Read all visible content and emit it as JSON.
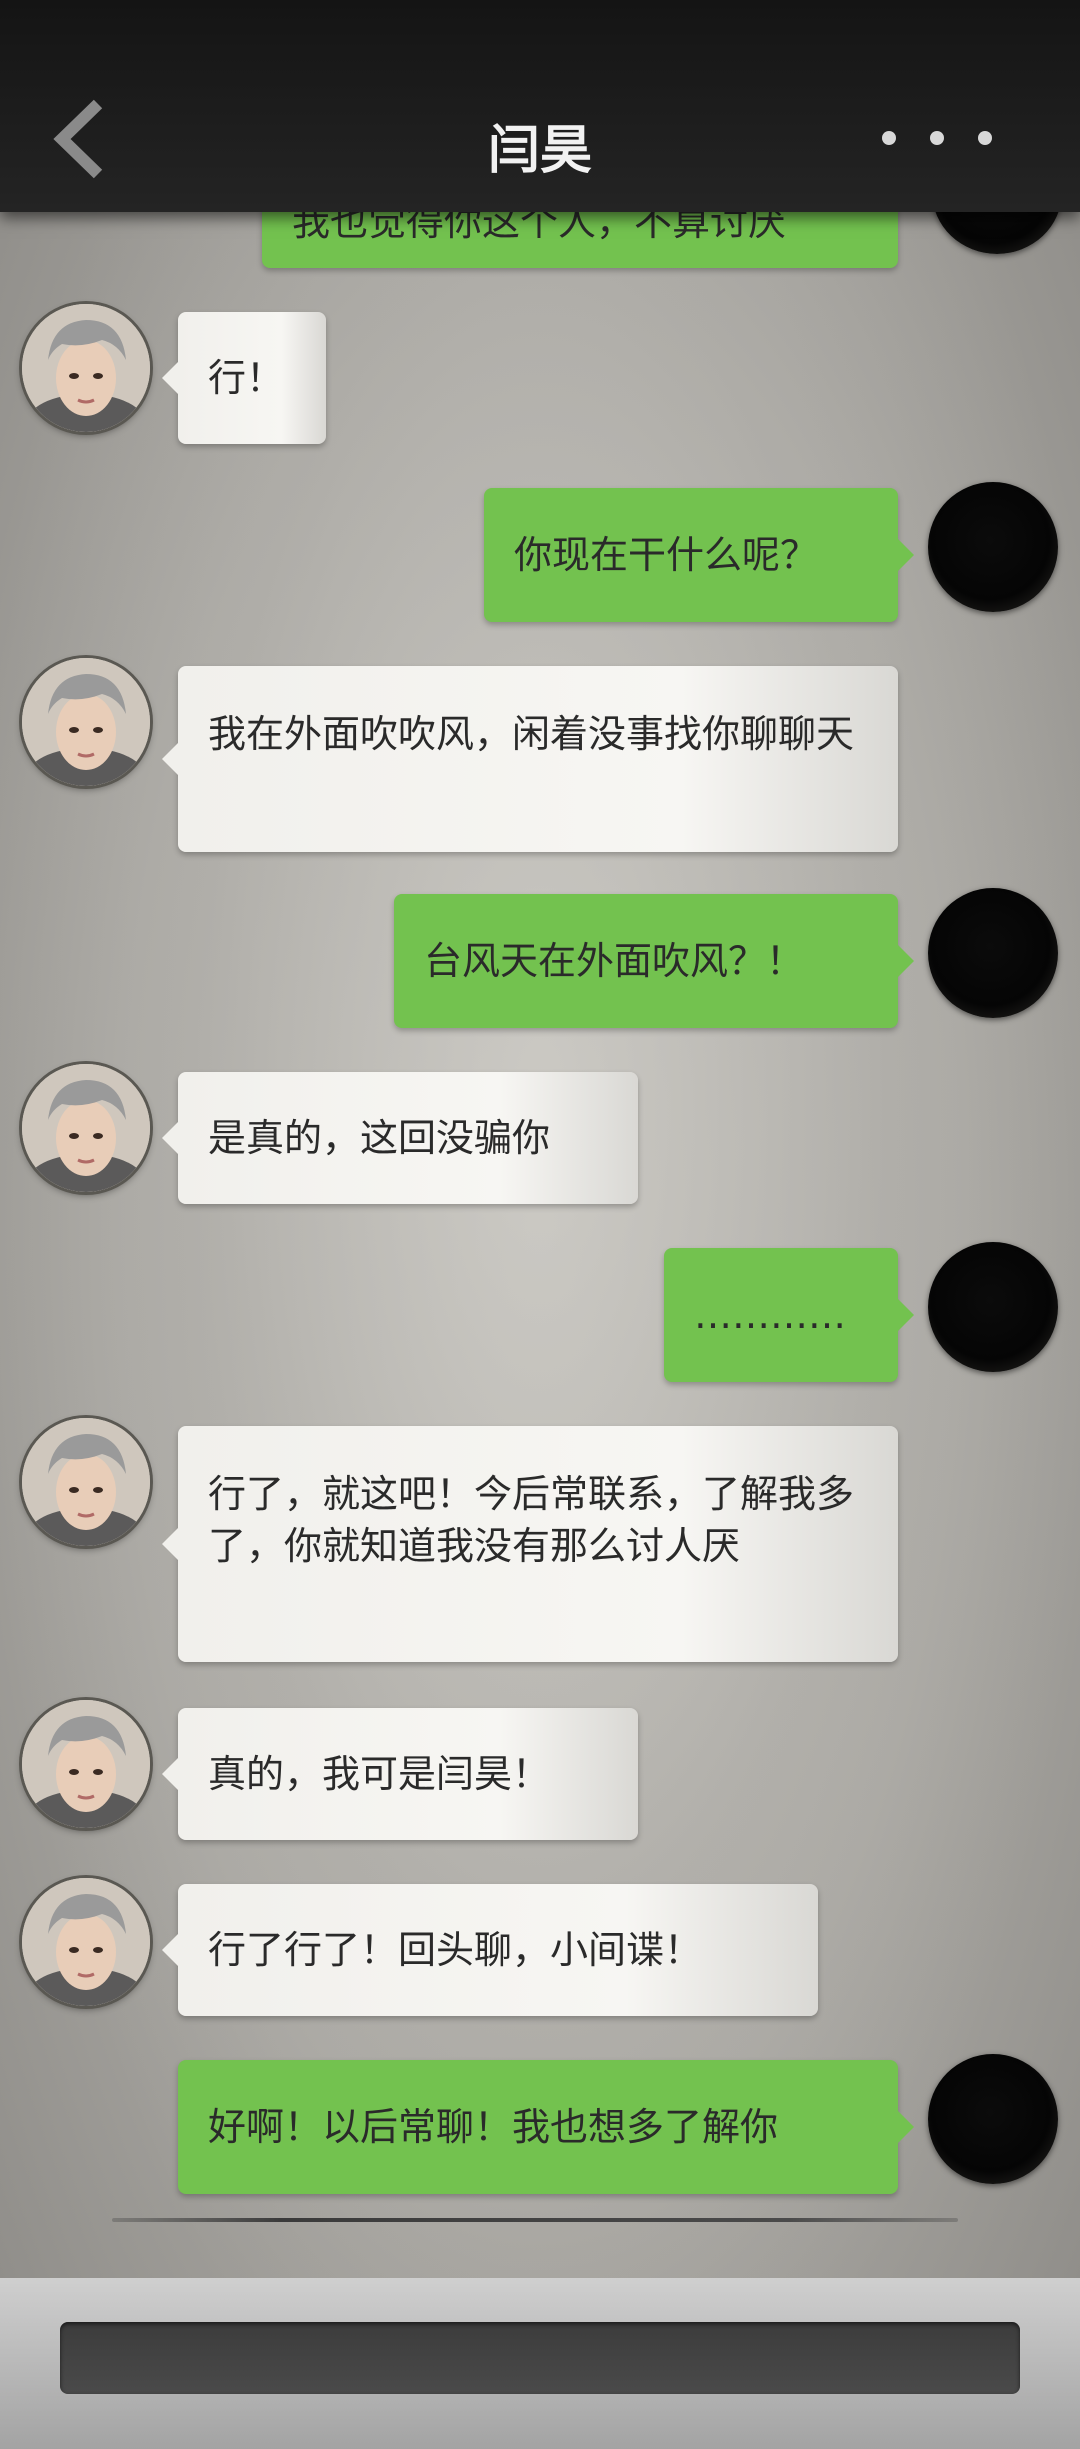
{
  "header": {
    "title": "闫昊",
    "back_icon": "chevron-left-icon",
    "more_icon": "more-dots-icon"
  },
  "messages": [
    {
      "side": "right",
      "text": "我也觉得你这个人，不算讨厌",
      "partial": true
    },
    {
      "side": "left",
      "text": "行！"
    },
    {
      "side": "right",
      "text": "你现在干什么呢？"
    },
    {
      "side": "left",
      "text": "我在外面吹吹风，闲着没事找你聊聊天"
    },
    {
      "side": "right",
      "text": "台风天在外面吹风？！"
    },
    {
      "side": "left",
      "text": "是真的，这回没骗你"
    },
    {
      "side": "right",
      "text": "…………"
    },
    {
      "side": "left",
      "text": "行了，就这吧！今后常联系，了解我多了，你就知道我没有那么讨人厌"
    },
    {
      "side": "left",
      "text": "真的，我可是闫昊！"
    },
    {
      "side": "left",
      "text": "行了行了！回头聊，小间谍！"
    },
    {
      "side": "right",
      "text": "好啊！以后常聊！我也想多了解你"
    }
  ],
  "input": {
    "placeholder": ""
  },
  "colors": {
    "green_bubble": "#73c24f",
    "white_bubble": "#f3f2ee",
    "header_bg": "#1c1c1c"
  }
}
